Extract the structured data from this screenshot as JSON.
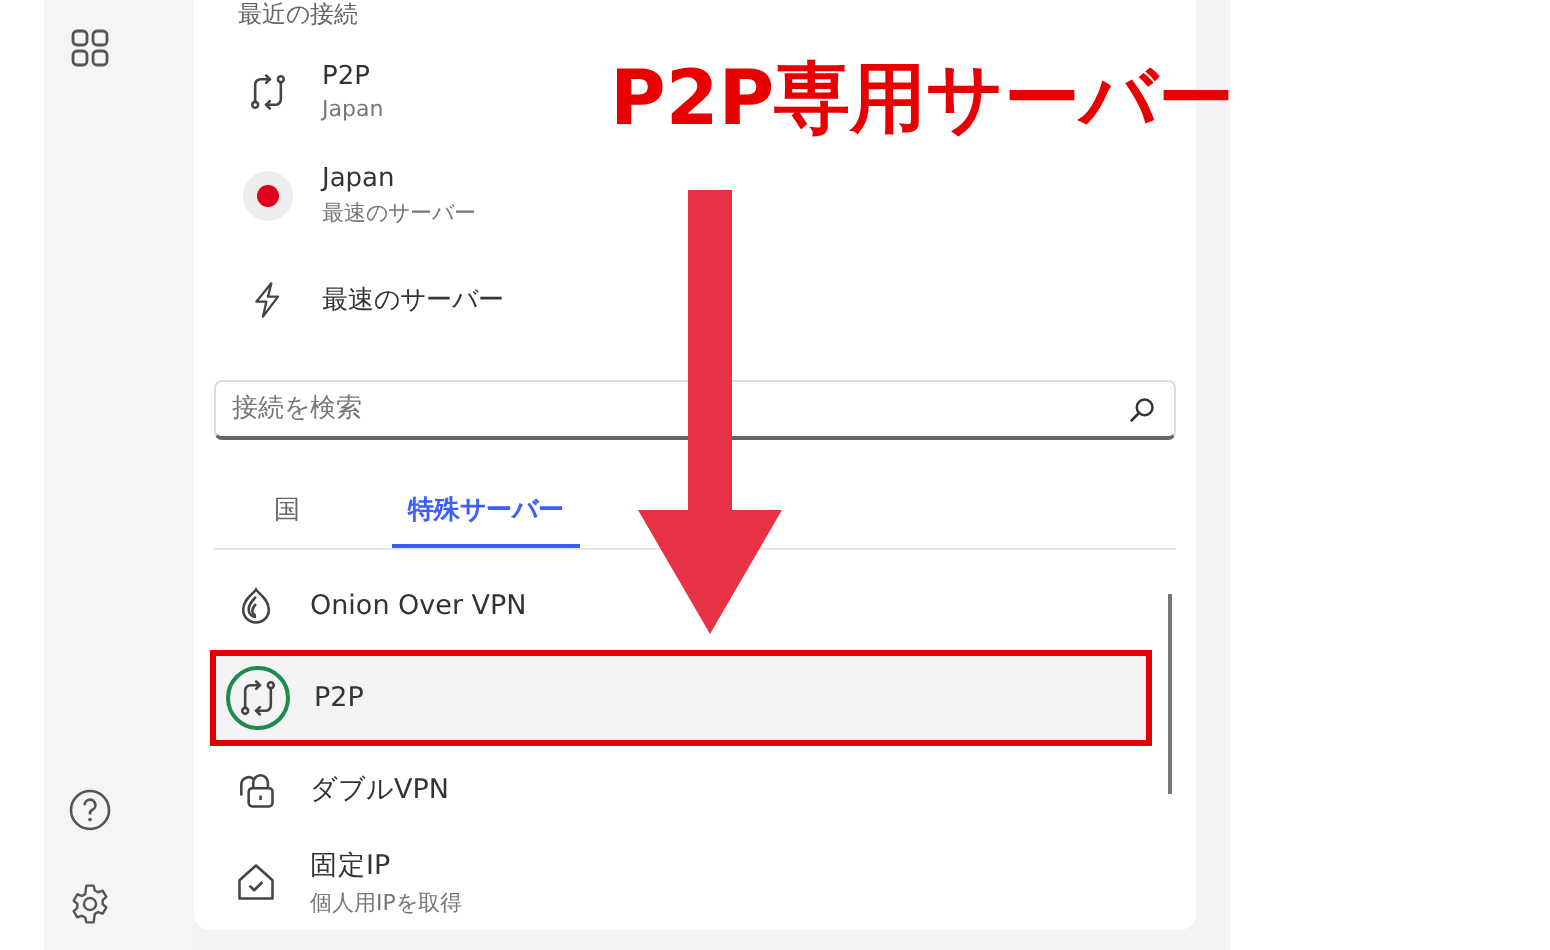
{
  "annotation": {
    "title": "P2P専用サーバー"
  },
  "recent": {
    "heading": "最近の接続",
    "items": [
      {
        "kind": "p2p",
        "title": "P2P",
        "subtitle": "Japan"
      },
      {
        "kind": "flag",
        "title": "Japan",
        "subtitle": "最速のサーバー"
      },
      {
        "kind": "bolt",
        "title": "最速のサーバー"
      }
    ]
  },
  "search": {
    "placeholder": "接続を検索"
  },
  "tabs": [
    {
      "label": "国",
      "selected": false
    },
    {
      "label": "特殊サーバー",
      "selected": true
    }
  ],
  "servers": [
    {
      "kind": "onion",
      "name": "Onion Over VPN",
      "highlighted": false
    },
    {
      "kind": "p2p",
      "name": "P2P",
      "highlighted": true
    },
    {
      "kind": "double",
      "name": "ダブルVPN",
      "highlighted": false
    },
    {
      "kind": "dedicated",
      "name": "固定IP",
      "subtitle": "個人用IPを取得",
      "highlighted": false
    }
  ]
}
